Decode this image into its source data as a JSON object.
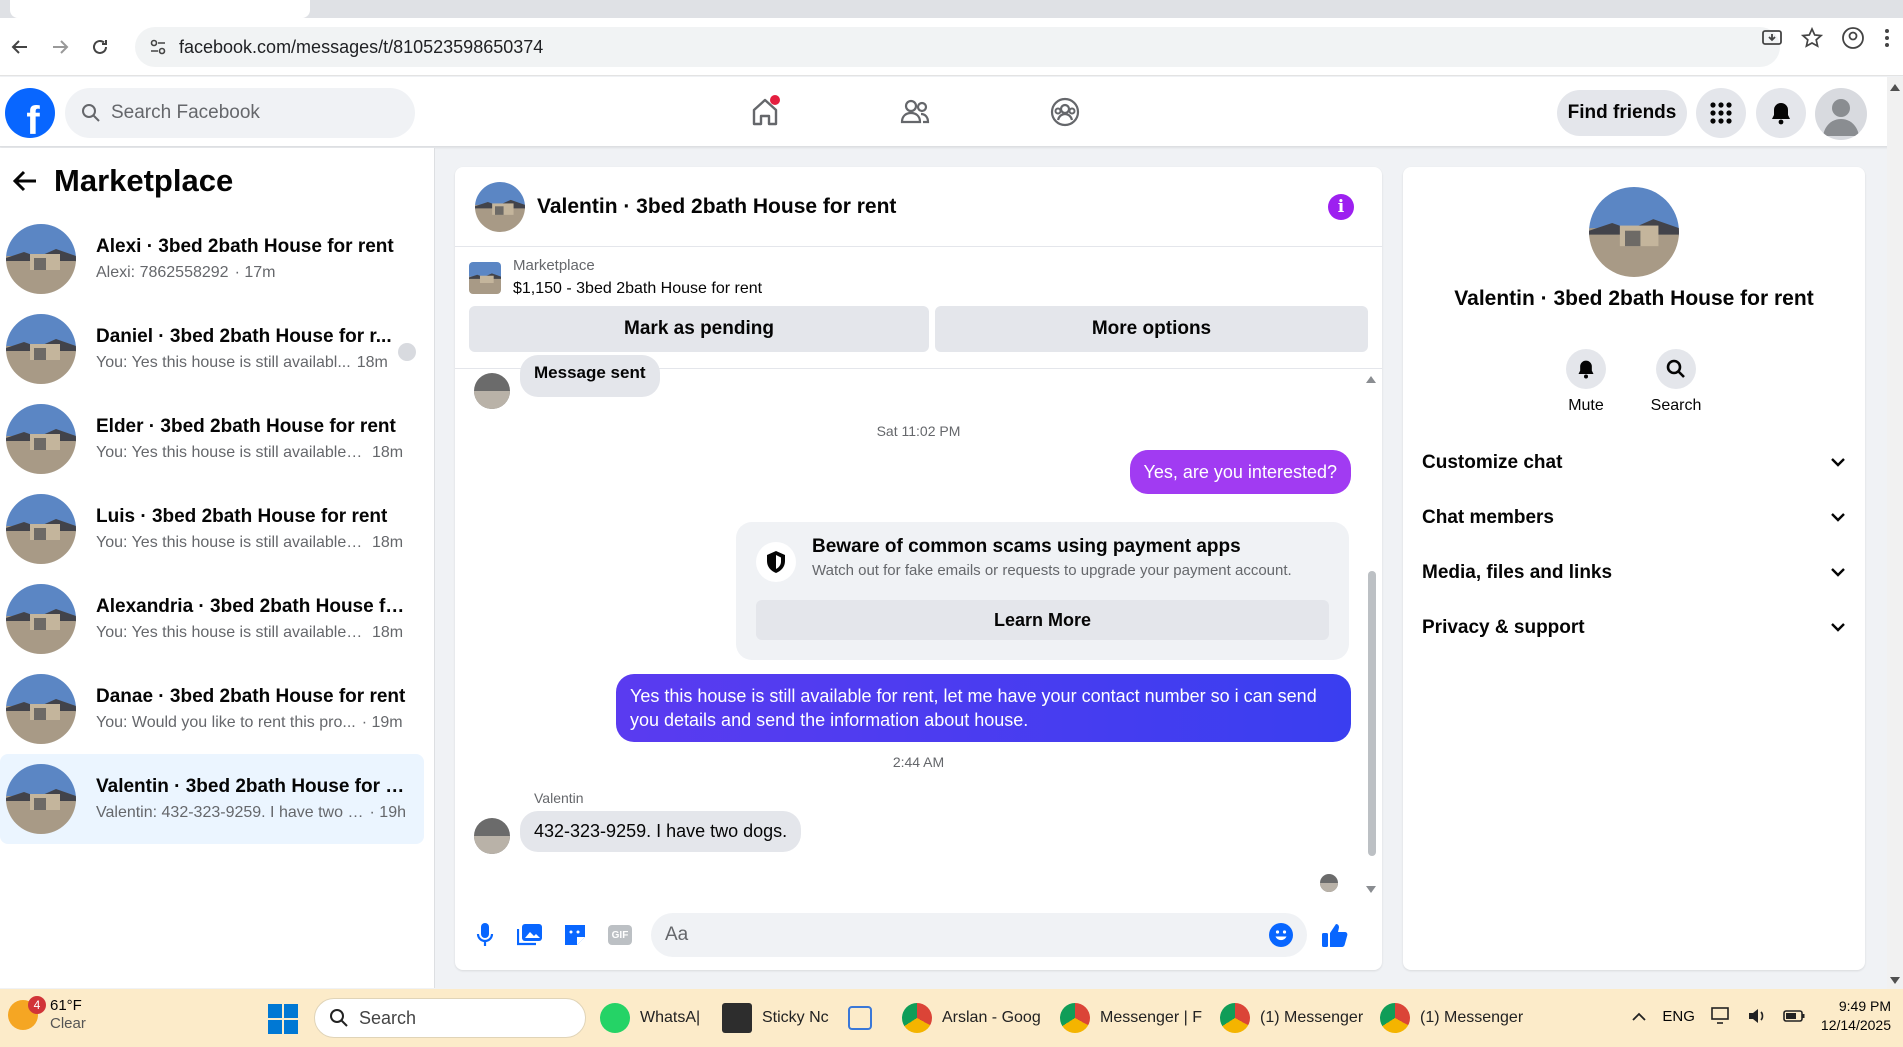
{
  "browser": {
    "url": "facebook.com/messages/t/810523598650374"
  },
  "fb": {
    "search_placeholder": "Search Facebook",
    "find_friends": "Find friends"
  },
  "sidebar": {
    "title": "Marketplace",
    "conversations": [
      {
        "name": "Alexi · 3bed 2bath House for rent",
        "message": "Alexi: 7862558292",
        "time": "· 17m"
      },
      {
        "name": "Daniel · 3bed 2bath House for r...",
        "message": "You: Yes this house is still availabl...",
        "time": "18m"
      },
      {
        "name": "Elder · 3bed 2bath House for rent",
        "message": "You: Yes this house is still available f...",
        "time": "18m"
      },
      {
        "name": "Luis · 3bed 2bath House for rent",
        "message": "You: Yes this house is still available f...",
        "time": "18m"
      },
      {
        "name": "Alexandria · 3bed 2bath House for...",
        "message": "You: Yes this house is still available f...",
        "time": "18m"
      },
      {
        "name": "Danae · 3bed 2bath House for rent",
        "message": "You: Would you like to rent this pro...",
        "time": "· 19m"
      },
      {
        "name": "Valentin · 3bed 2bath House for rent",
        "message": "Valentin: 432-323-9259. I have two d...",
        "time": "· 19h"
      }
    ]
  },
  "chat": {
    "title": "Valentin · 3bed 2bath House for rent",
    "listing_label": "Marketplace",
    "listing_title": "$1,150 - 3bed 2bath House for rent",
    "mark_pending": "Mark as pending",
    "more_options": "More options",
    "msg_sent": "Message sent",
    "ts1": "Sat 11:02 PM",
    "out1": "Yes, are you interested?",
    "scam_title": "Beware of common scams using payment apps",
    "scam_body": "Watch out for fake emails or requests to upgrade your payment account.",
    "learn_more": "Learn More",
    "out2": "Yes this house is still available for rent, let me have your contact number so i can send you details and send the information about house.",
    "ts2": "2:44 AM",
    "sender": "Valentin",
    "in1": "432-323-9259. I have two dogs.",
    "composer_placeholder": "Aa"
  },
  "right": {
    "name": "Valentin · 3bed 2bath House for rent",
    "mute": "Mute",
    "search": "Search",
    "sections": [
      "Customize chat",
      "Chat members",
      "Media, files and links",
      "Privacy & support"
    ]
  },
  "taskbar": {
    "badge": "4",
    "temp": "61°F",
    "cond": "Clear",
    "search": "Search",
    "apps": [
      "WhatsA|",
      "Sticky Nc",
      "Arslan - Goog",
      "Messenger | F",
      "(1) Messenger",
      "(1) Messenger"
    ],
    "lang": "ENG",
    "time": "9:49 PM",
    "date": "12/14/2025"
  },
  "colors": {
    "fb_blue": "#0866ff",
    "purple": "#a020f0",
    "out_gradient_end": "#3d3bf0"
  }
}
